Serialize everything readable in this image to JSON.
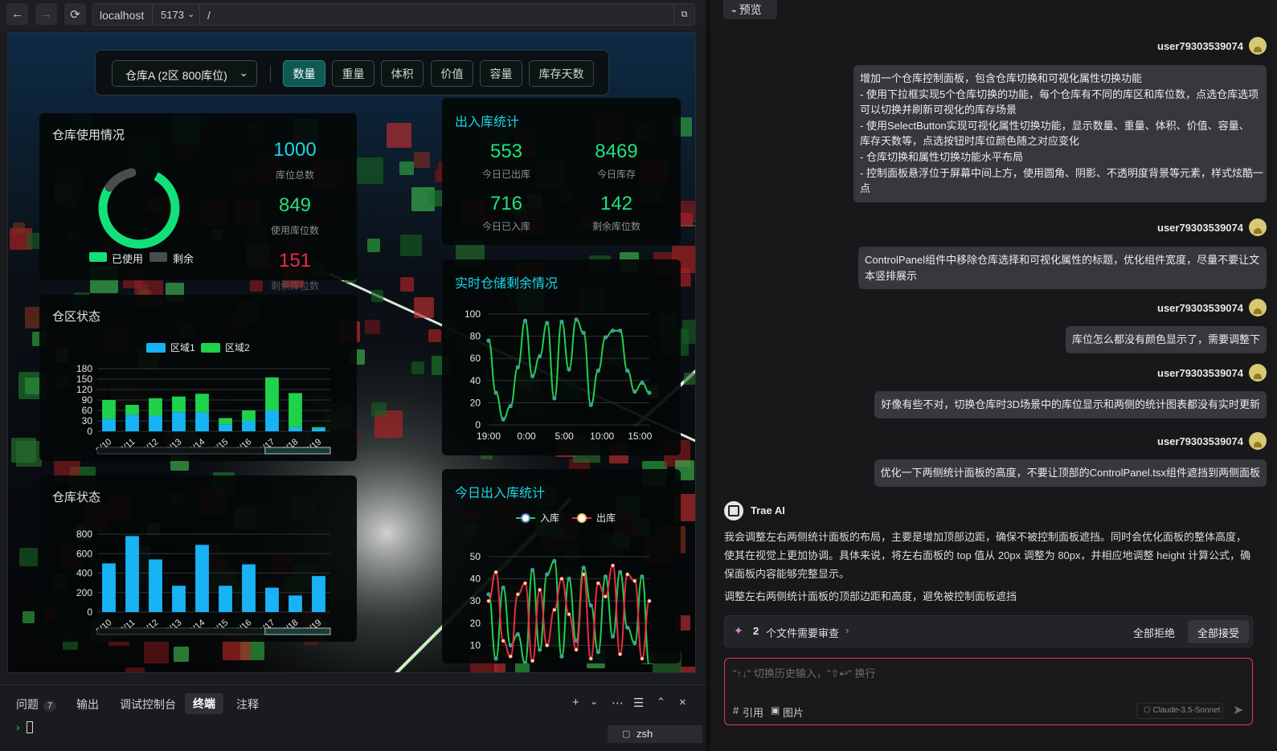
{
  "browser": {
    "url_host": "localhost",
    "url_port": "5173",
    "url_path": "/"
  },
  "control_panel": {
    "warehouse_select": "仓库A (2区 800库位)",
    "attributes": [
      {
        "label": "数量",
        "active": true
      },
      {
        "label": "重量",
        "active": false
      },
      {
        "label": "体积",
        "active": false
      },
      {
        "label": "价值",
        "active": false
      },
      {
        "label": "容量",
        "active": false
      },
      {
        "label": "库存天数",
        "active": false
      }
    ]
  },
  "usage_panel": {
    "title": "仓库使用情况",
    "legend_used": "已使用",
    "legend_free": "剩余",
    "total_value": "1000",
    "total_label": "库位总数",
    "used_value": "849",
    "used_label": "使用库位数",
    "free_value": "151",
    "free_label": "剩余库位数"
  },
  "io_panel": {
    "title": "出入库统计",
    "out_value": "553",
    "out_label": "今日已出库",
    "stock_value": "8469",
    "stock_label": "今日库存",
    "in_value": "716",
    "in_label": "今日已入库",
    "free_value": "142",
    "free_label": "剩余库位数"
  },
  "zone_panel": {
    "title": "仓区状态"
  },
  "warehouse_panel": {
    "title": "仓库状态"
  },
  "realtime_panel": {
    "title": "实时仓储剩余情况"
  },
  "today_panel": {
    "title": "今日出入库统计"
  },
  "chart_data": [
    {
      "type": "bar",
      "title": "仓区状态",
      "categories": [
        "2/10",
        "2/11",
        "2/12",
        "2/13",
        "2/14",
        "2/15",
        "2/16",
        "2/17",
        "2/18",
        "2/19"
      ],
      "series": [
        {
          "name": "区域1",
          "values": [
            36,
            48,
            45,
            55,
            54,
            20,
            30,
            60,
            12,
            9
          ]
        },
        {
          "name": "区域2",
          "values": [
            54,
            28,
            50,
            45,
            54,
            18,
            30,
            95,
            98,
            3
          ]
        }
      ],
      "stacked": true,
      "yticks": [
        0,
        30,
        60,
        90,
        120,
        150,
        180
      ],
      "ylim": [
        0,
        180
      ],
      "legend": "top"
    },
    {
      "type": "bar",
      "title": "仓库状态",
      "categories": [
        "2/10",
        "2/11",
        "2/12",
        "2/13",
        "2/14",
        "2/15",
        "2/16",
        "2/17",
        "2/18",
        "2/19"
      ],
      "series": [
        {
          "values": [
            500,
            780,
            540,
            270,
            690,
            270,
            490,
            250,
            170,
            370
          ]
        }
      ],
      "yticks": [
        0,
        200,
        400,
        600,
        800
      ],
      "ylim": [
        0,
        800
      ]
    },
    {
      "type": "line",
      "title": "实时仓储剩余情况",
      "xticks": [
        "19:00",
        "0:00",
        "5:00",
        "10:00",
        "15:00"
      ],
      "yticks": [
        0,
        20,
        40,
        60,
        80,
        100
      ],
      "ylim": [
        0,
        100
      ],
      "series": [
        {
          "values": [
            76,
            29,
            5,
            17,
            52,
            94,
            44,
            62,
            92,
            24,
            93,
            50,
            95,
            83,
            18,
            49,
            79,
            85,
            85,
            49,
            30,
            38,
            29
          ]
        }
      ]
    },
    {
      "type": "line",
      "title": "今日出入库统计",
      "xticks": [
        "19:00",
        "0:00",
        "5:00",
        "10:00",
        "15:00"
      ],
      "yticks": [
        0,
        10,
        20,
        30,
        40,
        50
      ],
      "ylim": [
        0,
        50
      ],
      "legend": "top",
      "series": [
        {
          "name": "入库",
          "values": [
            33,
            4,
            36,
            10,
            15,
            2,
            44,
            8,
            42,
            48,
            5,
            40,
            12,
            45,
            28,
            7,
            41,
            14,
            43,
            18,
            11,
            41,
            1
          ]
        },
        {
          "name": "出库",
          "values": [
            30,
            43,
            12,
            5,
            33,
            38,
            3,
            35,
            10,
            26,
            40,
            24,
            8,
            42,
            4,
            38,
            32,
            46,
            6,
            42,
            39,
            4,
            30
          ]
        }
      ]
    }
  ],
  "bottom_panel": {
    "tabs": [
      {
        "label": "问题",
        "badge": "7"
      },
      {
        "label": "输出"
      },
      {
        "label": "调试控制台"
      },
      {
        "label": "终端",
        "active": true
      },
      {
        "label": "注释"
      }
    ],
    "prompt": "›",
    "shell": "zsh"
  },
  "chat": {
    "preview_label": "预览",
    "messages": [
      {
        "user": "user79303539074",
        "lines": [
          "增加一个仓库控制面板，包含仓库切换和可视化属性切换功能",
          "- 使用下拉框实现5个仓库切换的功能，每个仓库有不同的库区和库位数，点选仓库选项",
          "可以切换并刷新可视化的库存场景",
          "- 使用SelectButton实现可视化属性切换功能，显示数量、重量、体积、价值、容量、",
          "库存天数等，点选按钮时库位颜色随之对应变化",
          "- 仓库切换和属性切换功能水平布局",
          "- 控制面板悬浮位于屏幕中间上方，使用圆角、阴影、不透明度背景等元素，样式炫酷一",
          "点"
        ]
      },
      {
        "user": "user79303539074",
        "lines": [
          "ControlPanel组件中移除仓库选择和可视化属性的标题，优化组件宽度，尽量不要让文",
          "本竖排展示"
        ]
      },
      {
        "user": "user79303539074",
        "lines": [
          "库位怎么都没有颜色显示了，需要调整下"
        ]
      },
      {
        "user": "user79303539074",
        "lines": [
          "好像有些不对，切换仓库时3D场景中的库位显示和两侧的统计图表都没有实时更新"
        ]
      },
      {
        "user": "user79303539074",
        "lines": [
          "优化一下两侧统计面板的高度，不要让顶部的ControlPanel.tsx组件遮挡到两侧面板"
        ]
      }
    ],
    "ai_name": "Trae AI",
    "ai_text_1": "我会调整左右两侧统计面板的布局，主要是增加顶部边距，确保不被控制面板遮挡。同时会优化面板的整体高度，使其在视觉上更加协调。具体来说，将左右面板的 top 值从 20px 调整为 80px，并相应地调整 height 计算公式，确保面板内容能够完整显示。",
    "ai_text_2": "调整左右两侧统计面板的顶部边距和高度，避免被控制面板遮挡",
    "review_count": "2",
    "review_text": "个文件需要审查",
    "reject_all": "全部拒绝",
    "accept_all": "全部接受",
    "input_placeholder": "\"↑↓\" 切换历史输入，\"⇧↩\" 换行",
    "quote_label": "引用",
    "image_label": "图片",
    "model": "Claude-3.5-Sonnet"
  },
  "colors": {
    "accent_teal": "#0f5954",
    "used_green": "#12e07a",
    "free_gray": "#4c4c4c",
    "zone1_blue": "#18b3f4",
    "zone2_green": "#1fd14b",
    "cyan_title": "#19d7e6",
    "red_number": "#ee2b45",
    "green_number": "#1fe37a"
  }
}
